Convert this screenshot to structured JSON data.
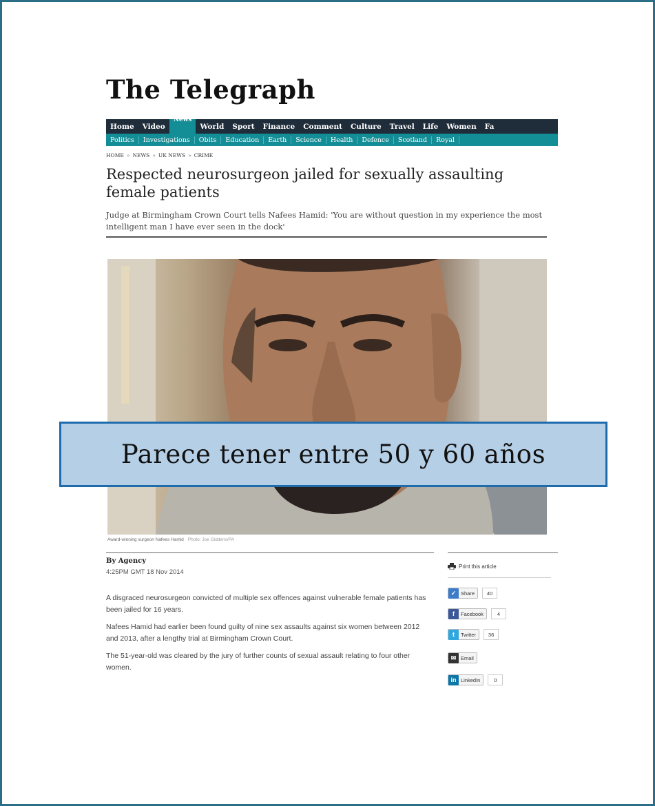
{
  "masthead": {
    "title": "The Telegraph"
  },
  "nav": {
    "primary": [
      {
        "label": "Home"
      },
      {
        "label": "Video"
      },
      {
        "label": "News",
        "active": true
      },
      {
        "label": "World"
      },
      {
        "label": "Sport"
      },
      {
        "label": "Finance"
      },
      {
        "label": "Comment"
      },
      {
        "label": "Culture"
      },
      {
        "label": "Travel"
      },
      {
        "label": "Life"
      },
      {
        "label": "Women"
      },
      {
        "label": "Fa"
      }
    ],
    "secondary": [
      {
        "label": "Politics"
      },
      {
        "label": "Investigations"
      },
      {
        "label": "Obits"
      },
      {
        "label": "Education"
      },
      {
        "label": "Earth"
      },
      {
        "label": "Science"
      },
      {
        "label": "Health"
      },
      {
        "label": "Defence"
      },
      {
        "label": "Scotland"
      },
      {
        "label": "Royal"
      }
    ],
    "accent_dark": "#1f2d3a",
    "accent_teal": "#148e96"
  },
  "breadcrumb": [
    "HOME",
    "NEWS",
    "UK NEWS",
    "CRIME"
  ],
  "article": {
    "headline": "Respected neurosurgeon jailed for sexually assaulting female patients",
    "standfirst": "Judge at Birmingham Crown Court tells Nafees Hamid: 'You are without question in my experience the most intelligent man I have ever seen in the dock'",
    "photo_caption": "Award-winning surgeon Nafees Hamid",
    "photo_credit": "Photo: Joe Giddens/PA",
    "byline": "By Agency",
    "timestamp": "4:25PM GMT 18 Nov 2014",
    "paragraphs": [
      "A disgraced neurosurgeon convicted of multiple sex offences against vulnerable female patients has been jailed for 16 years.",
      "Nafees Hamid had earlier been found guilty of nine sex assaults against six women between 2012 and 2013, after a lengthy trial at Birmingham Crown Court.",
      "The 51-year-old was cleared by the jury of further counts of sexual assault relating to four other women."
    ]
  },
  "share": {
    "print_label": "Print this article",
    "buttons": [
      {
        "label": "Share",
        "count": "40",
        "icon": "share-icon",
        "color": "#3d7cc9",
        "glyph": "✓"
      },
      {
        "label": "Facebook",
        "count": "4",
        "icon": "facebook-icon",
        "color": "#3b5998",
        "glyph": "f"
      },
      {
        "label": "Twitter",
        "count": "36",
        "icon": "twitter-icon",
        "color": "#2fa8e0",
        "glyph": "t"
      },
      {
        "label": "Email",
        "count": "",
        "icon": "email-icon",
        "color": "#333333",
        "glyph": "✉"
      },
      {
        "label": "LinkedIn",
        "count": "0",
        "icon": "linkedin-icon",
        "color": "#0e76a8",
        "glyph": "in"
      }
    ]
  },
  "callout": {
    "text": "Parece tener entre 50 y 60 años",
    "fill": "#b5cfe6",
    "border": "#1f6cad"
  },
  "frame_color": "#2b6f86"
}
